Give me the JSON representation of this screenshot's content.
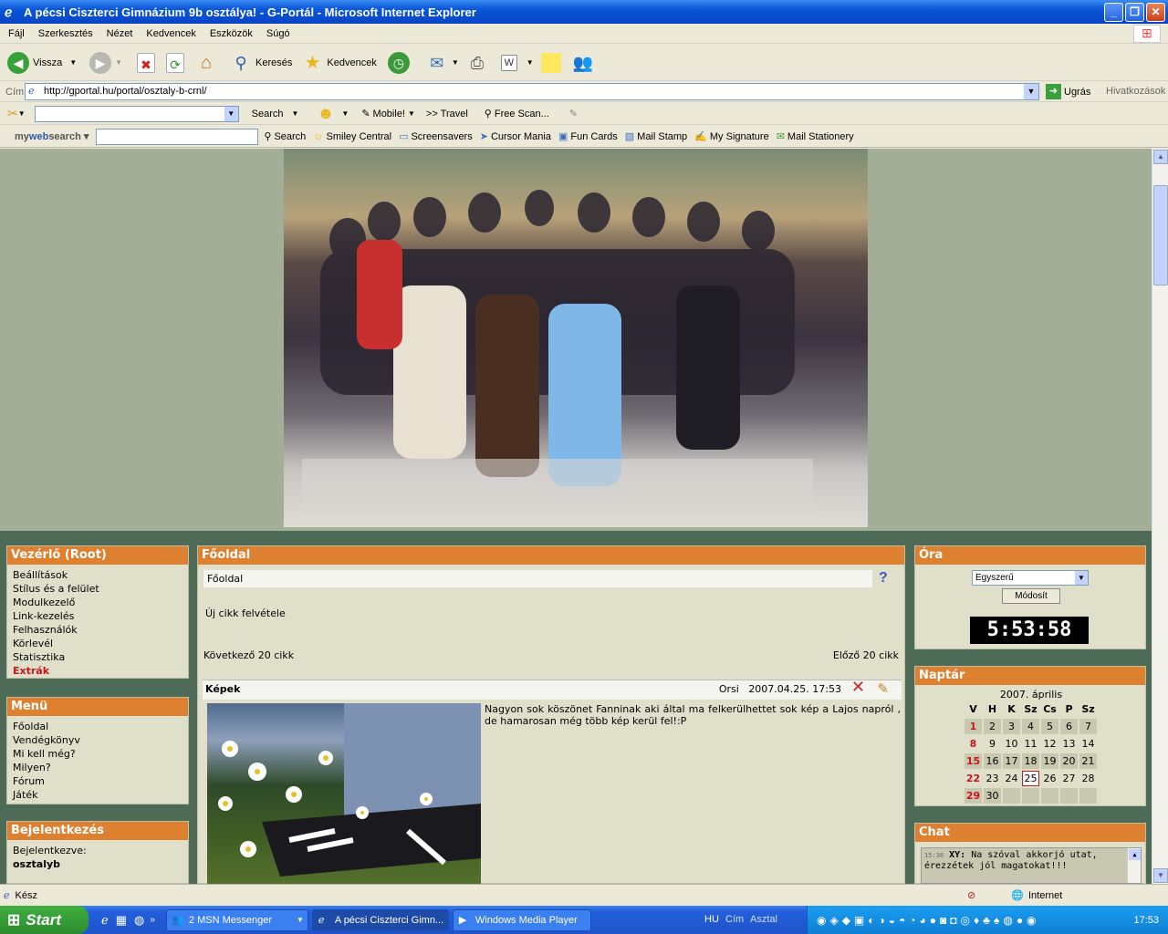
{
  "window": {
    "title": "A pécsi Ciszterci Gimnázium 9b osztálya! - G-Portál - Microsoft Internet Explorer"
  },
  "menubar": {
    "items": [
      "Fájl",
      "Szerkesztés",
      "Nézet",
      "Kedvencek",
      "Eszközök",
      "Súgó"
    ]
  },
  "toolbar": {
    "back": "Vissza",
    "search": "Keresés",
    "favorites": "Kedvencek"
  },
  "address": {
    "label": "Cím",
    "url": "http://gportal.hu/portal/osztaly-b-crnl/",
    "go": "Ugrás",
    "links": "Hivatkozások"
  },
  "linkbar": {
    "search": "Search",
    "mobile": "Mobile!",
    "travel": ">> Travel",
    "freescan": "Free Scan..."
  },
  "mwsbar": {
    "logo_my": "my",
    "logo_web": "web",
    "logo_search": "search",
    "search": "Search",
    "items": [
      "Smiley Central",
      "Screensavers",
      "Cursor Mania",
      "Fun Cards",
      "Mail Stamp",
      "My Signature",
      "Mail Stationery"
    ]
  },
  "left": {
    "control": {
      "title": "Vezérlő (Root)",
      "items": [
        "Beállítások",
        "Stílus és a felület",
        "Modulkezelő",
        "Link-kezelés",
        "Felhasználók",
        "Körlevél",
        "Statisztika"
      ],
      "extra": "Extrák"
    },
    "menu": {
      "title": "Menü",
      "items": [
        "Főoldal",
        "Vendégkönyv",
        "Mi kell még?",
        "Milyen?",
        "Fórum",
        "Játék"
      ]
    },
    "login": {
      "title": "Bejelentkezés",
      "label": "Bejelentkezve:",
      "user": "osztalyb"
    }
  },
  "main": {
    "title": "Főoldal",
    "breadcrumb": "Főoldal",
    "help": "?",
    "new_article": "Új cikk felvétele",
    "next": "Következő 20 cikk",
    "prev": "Előző 20 cikk",
    "article": {
      "title": "Képek",
      "author": "Orsi",
      "date": "2007.04.25. 17:53",
      "text": "Nagyon sok köszönet Fanninak aki által ma felkerülhettet sok kép a Lajos napról , de hamarosan még több kép kerül fel!:P"
    }
  },
  "right": {
    "clock": {
      "title": "Óra",
      "select": "Egyszerű",
      "button": "Módosít",
      "time": "5:53:58"
    },
    "calendar": {
      "title": "Naptár",
      "month": "2007. április",
      "days": [
        "V",
        "H",
        "K",
        "Sz",
        "Cs",
        "P",
        "Sz"
      ],
      "weeks": [
        [
          "1",
          "2",
          "3",
          "4",
          "5",
          "6",
          "7"
        ],
        [
          "8",
          "9",
          "10",
          "11",
          "12",
          "13",
          "14"
        ],
        [
          "15",
          "16",
          "17",
          "18",
          "19",
          "20",
          "21"
        ],
        [
          "22",
          "23",
          "24",
          "25",
          "26",
          "27",
          "28"
        ],
        [
          "29",
          "30",
          "",
          "",
          "",
          "",
          ""
        ]
      ],
      "today": "25"
    },
    "chat": {
      "title": "Chat",
      "time": "15:36",
      "user": "XY:",
      "msg": "Na szóval akkorjó utat, érezzétek jól magatokat!!!"
    }
  },
  "status": {
    "left": "Kész",
    "zone": "Internet"
  },
  "taskbar": {
    "start": "Start",
    "tasks": [
      "2 MSN Messenger",
      "A pécsi Ciszterci Gimn...",
      "Windows Media Player"
    ],
    "lang": "HU",
    "addr": "Cím",
    "desk": "Asztal",
    "time": "17:53"
  }
}
